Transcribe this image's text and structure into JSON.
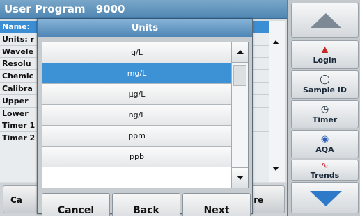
{
  "background": {
    "title": "User Program",
    "title_number": "9000",
    "rows": [
      "Name:",
      "Units: r",
      "Wavele",
      "Resolu",
      "Chemic",
      "Calibra",
      "Upper",
      "Lower",
      "Timer 1",
      "Timer 2"
    ],
    "bottom_left_label": "Ca",
    "bottom_right_label": "ore"
  },
  "dialog": {
    "title": "Units",
    "options": [
      "g/L",
      "mg/L",
      "µg/L",
      "ng/L",
      "ppm",
      "ppb"
    ],
    "selected_index": 1,
    "cancel_label": "Cancel",
    "back_label": "Back",
    "next_label": "Next"
  },
  "sidebar": {
    "login_label": "Login",
    "sample_label": "Sample ID",
    "timer_label": "Timer",
    "aqa_label": "AQA",
    "trends_label": "Trends"
  },
  "colors": {
    "accent_blue": "#3d92d6",
    "title_bar": "#4f86b5"
  }
}
